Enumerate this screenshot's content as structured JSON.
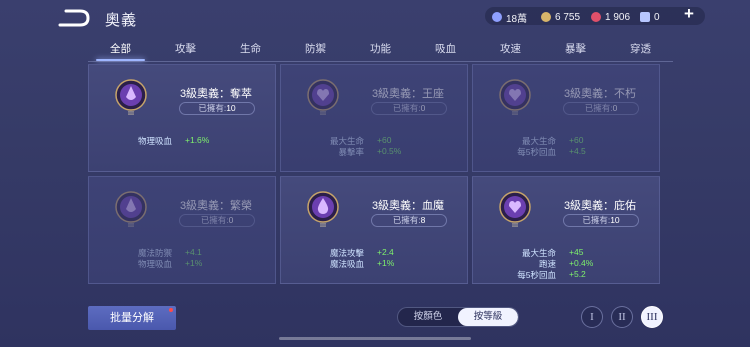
{
  "header": {
    "title": "奧義",
    "resources": [
      {
        "icon": "diamond-icon",
        "value": "18萬",
        "color": "#8fa0ff"
      },
      {
        "icon": "gold-coin-icon",
        "value": "6 755",
        "color": "#d8b56a"
      },
      {
        "icon": "red-gem-icon",
        "value": "1 906",
        "color": "#e0506a"
      },
      {
        "icon": "ticket-icon",
        "value": "0",
        "color": "#b7c6ff"
      }
    ],
    "plus_label": "+"
  },
  "tabs": [
    "全部",
    "攻擊",
    "生命",
    "防禦",
    "功能",
    "吸血",
    "攻速",
    "暴擊",
    "穿透"
  ],
  "active_tab": 0,
  "cards": [
    {
      "name": "3級奧義：奪萃",
      "owned_label": "已擁有:",
      "owned_count": "10",
      "dim": false,
      "stats": [
        {
          "name": "物理吸血",
          "value": "+1.6%"
        }
      ]
    },
    {
      "name": "3級奧義：王座",
      "owned_label": "已擁有:",
      "owned_count": "0",
      "dim": true,
      "stats": [
        {
          "name": "最大生命",
          "value": "+60"
        },
        {
          "name": "暴擊率",
          "value": "+0.5%"
        }
      ]
    },
    {
      "name": "3級奧義：不朽",
      "owned_label": "已擁有:",
      "owned_count": "0",
      "dim": true,
      "stats": [
        {
          "name": "最大生命",
          "value": "+60"
        },
        {
          "name": "每5秒回血",
          "value": "+4.5"
        }
      ]
    },
    {
      "name": "3級奧義：繁榮",
      "owned_label": "已擁有:",
      "owned_count": "0",
      "dim": true,
      "stats": [
        {
          "name": "魔法防禦",
          "value": "+4.1"
        },
        {
          "name": "物理吸血",
          "value": "+1%"
        }
      ]
    },
    {
      "name": "3級奧義：血魔",
      "owned_label": "已擁有:",
      "owned_count": "8",
      "dim": false,
      "stats": [
        {
          "name": "魔法攻擊",
          "value": "+2.4"
        },
        {
          "name": "魔法吸血",
          "value": "+1%"
        }
      ]
    },
    {
      "name": "3級奧義：庇佑",
      "owned_label": "已擁有:",
      "owned_count": "10",
      "dim": false,
      "stats": [
        {
          "name": "最大生命",
          "value": "+45"
        },
        {
          "name": "跑速",
          "value": "+0.4%"
        },
        {
          "name": "每5秒回血",
          "value": "+5.2"
        }
      ]
    }
  ],
  "bottom": {
    "batch_label": "批量分解",
    "sort_color": "按顏色",
    "sort_level": "按等級",
    "levels": [
      "I",
      "II",
      "III"
    ],
    "active_level": 2
  }
}
